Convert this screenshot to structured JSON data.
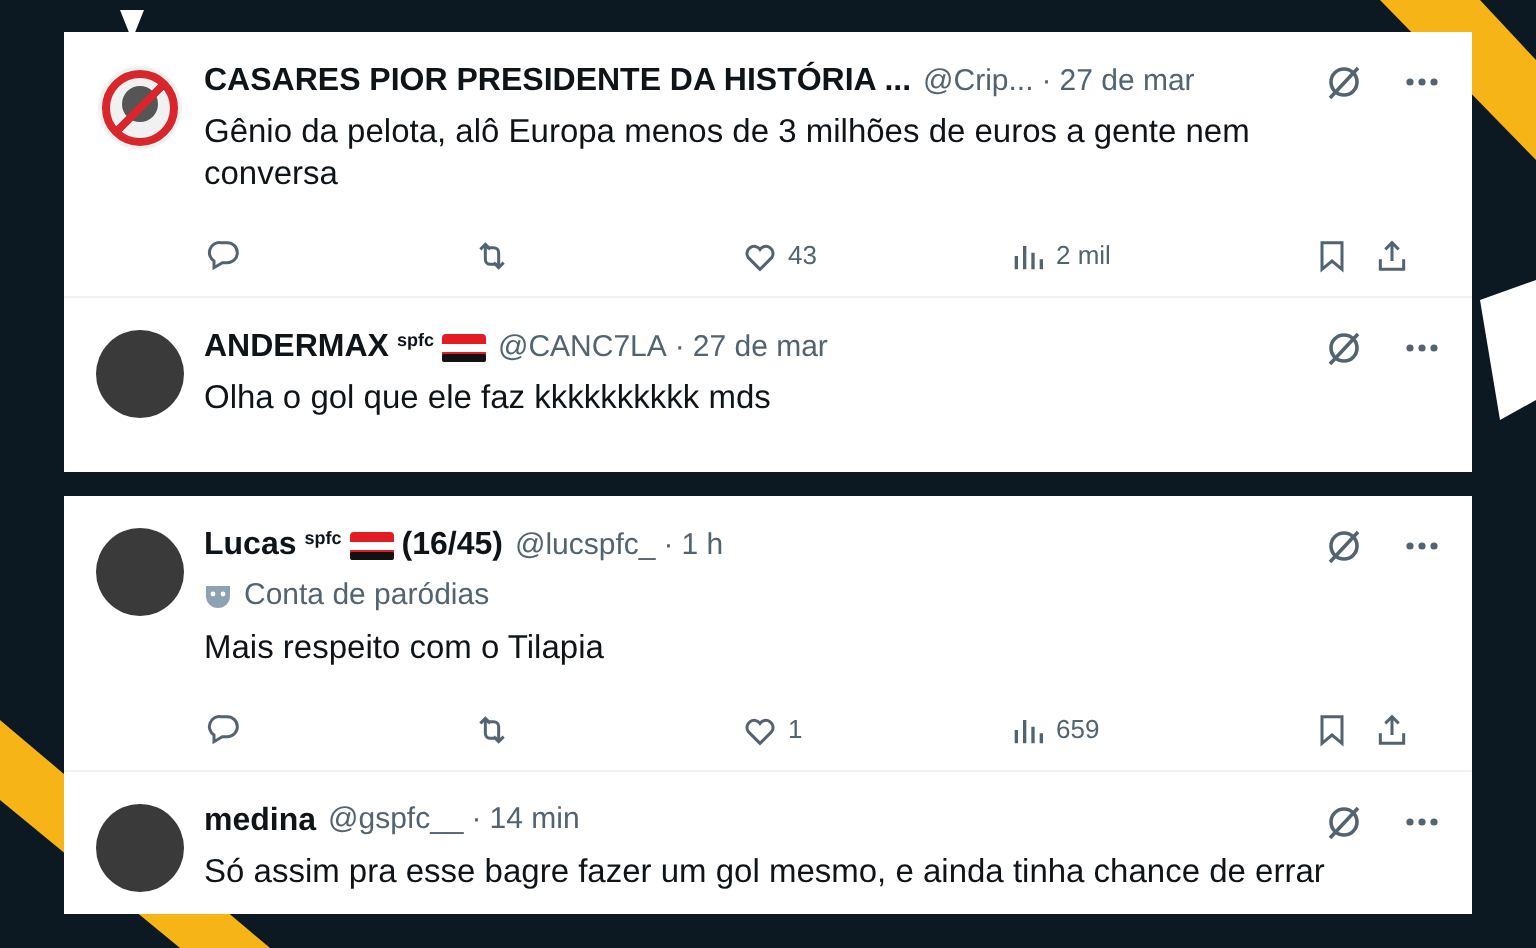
{
  "cards": [
    {
      "tweets": [
        {
          "avatar": {
            "kind": "banned"
          },
          "name": "CASARES PIOR PRESIDENTE DA HISTÓRIA ...",
          "handle": "@Crip...",
          "dot": "·",
          "time": "27 de mar",
          "text": "Gênio da pelota, alô Europa menos de 3 milhões de euros a gente nem conversa",
          "actions": [
            {
              "kind": "reply"
            },
            {
              "kind": "retweet"
            },
            {
              "kind": "like",
              "count": "43"
            },
            {
              "kind": "views",
              "count": "2 mil"
            },
            {
              "kind": "bookmark"
            },
            {
              "kind": "share"
            }
          ]
        },
        {
          "avatar": {
            "kind": "photo"
          },
          "name": "ANDERMAX",
          "badges": [
            {
              "kind": "text",
              "text": "spfc"
            },
            {
              "kind": "flag"
            }
          ],
          "handle": "@CANC7LA",
          "dot": "·",
          "time": "27 de mar",
          "text": "Olha o gol que ele faz kkkkkkkkkk mds"
        }
      ]
    },
    {
      "tweets": [
        {
          "avatar": {
            "kind": "photo"
          },
          "name": "Lucas",
          "badges": [
            {
              "kind": "text",
              "text": "spfc"
            },
            {
              "kind": "flag"
            }
          ],
          "name_suffix": "(16/45)",
          "handle": "@lucspfc_",
          "dot": "·",
          "time": "1 h",
          "label": "Conta de paródias",
          "text": "Mais respeito com o Tilapia",
          "actions": [
            {
              "kind": "reply"
            },
            {
              "kind": "retweet"
            },
            {
              "kind": "like",
              "count": "1"
            },
            {
              "kind": "views",
              "count": "659"
            },
            {
              "kind": "bookmark"
            },
            {
              "kind": "share"
            }
          ]
        },
        {
          "avatar": {
            "kind": "photo"
          },
          "name": "medina",
          "handle": "@gspfc__",
          "dot": "·",
          "time": "14 min",
          "text": "Só assim pra esse bagre fazer um gol mesmo, e ainda tinha chance de errar"
        }
      ]
    }
  ]
}
